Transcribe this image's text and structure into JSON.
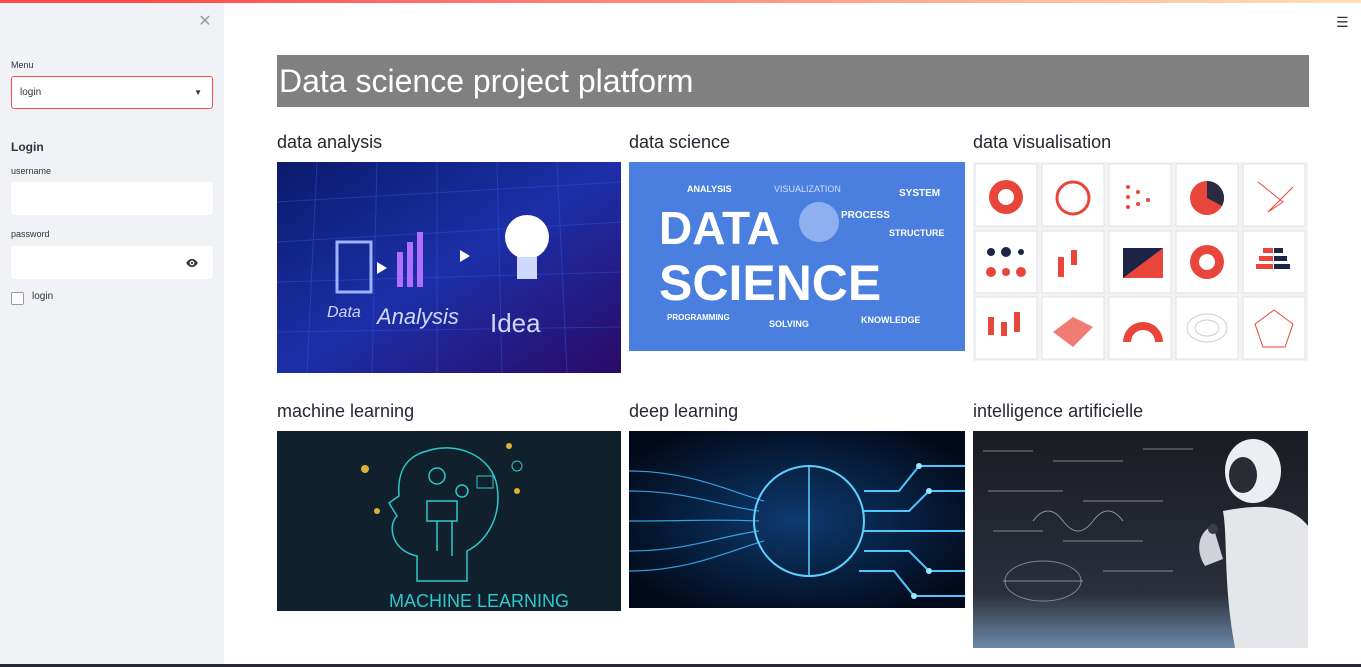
{
  "sidebar": {
    "close_icon": "close-icon",
    "menu_label": "Menu",
    "menu_selected": "login",
    "login_heading": "Login",
    "username_label": "username",
    "username_value": "",
    "password_label": "password",
    "password_value": "",
    "checkbox_label": "login",
    "checkbox_checked": false
  },
  "header": {
    "menu_icon": "hamburger-icon"
  },
  "main": {
    "title": "Data science project platform",
    "cards": [
      {
        "label": "data analysis"
      },
      {
        "label": "data science"
      },
      {
        "label": "data visualisation"
      },
      {
        "label": "machine learning"
      },
      {
        "label": "deep learning"
      },
      {
        "label": "intelligence artificielle"
      }
    ],
    "image_texts": {
      "analysis_words": [
        "Data",
        "Analysis",
        "Idea"
      ],
      "science_big": [
        "DATA",
        "SCIENCE"
      ],
      "science_words": [
        "ANALYSIS",
        "VISUALIZATION",
        "SYSTEM",
        "PROCESS",
        "STRUCTURE",
        "PROGRAMMING",
        "SOLVING",
        "KNOWLEDGE"
      ],
      "ml_caption": "MACHINE LEARNING"
    }
  },
  "colors": {
    "accent": "#ff4b4b",
    "title_bg": "#808080",
    "sidebar_bg": "#f0f2f6"
  }
}
